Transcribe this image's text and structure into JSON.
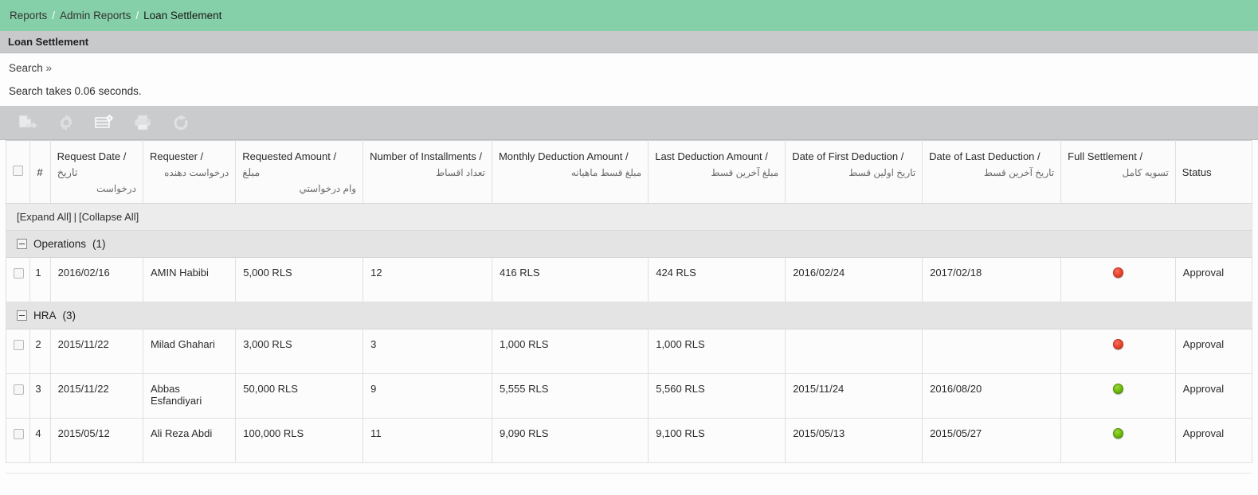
{
  "breadcrumb": {
    "items": [
      "Reports",
      "Admin Reports",
      "Loan Settlement"
    ],
    "separator": "/"
  },
  "page": {
    "title": "Loan Settlement"
  },
  "search": {
    "link_label": "Search",
    "chevron": "»",
    "timing_text": "Search takes 0.06 seconds."
  },
  "toolbar": {
    "buttons": [
      {
        "name": "export-document-icon",
        "title": "Export"
      },
      {
        "name": "settings-gear-icon",
        "title": "Settings"
      },
      {
        "name": "table-settings-icon",
        "title": "Column Settings"
      },
      {
        "name": "print-icon",
        "title": "Print"
      },
      {
        "name": "refresh-icon",
        "title": "Refresh"
      }
    ]
  },
  "grid": {
    "select_all_checkbox": false,
    "columns": [
      {
        "en": "#",
        "fa": ""
      },
      {
        "en": "Request Date /",
        "fa_inline": "تاریخ",
        "fa": "درخواست"
      },
      {
        "en": "Requester /",
        "fa_inline": "",
        "fa": "درخواست دهنده"
      },
      {
        "en": "Requested Amount /",
        "fa_inline": "مبلغ",
        "fa": "وام درخواستي"
      },
      {
        "en": "Number of Installments /",
        "fa_inline": "",
        "fa": "تعداد اقساط"
      },
      {
        "en": "Monthly Deduction Amount /",
        "fa_inline": "",
        "fa": "مبلغ قسط ماهیانه"
      },
      {
        "en": "Last Deduction Amount /",
        "fa_inline": "",
        "fa": "مبلغ آخرین قسط"
      },
      {
        "en": "Date of First Deduction /",
        "fa_inline": "",
        "fa": "تاریخ اولین قسط"
      },
      {
        "en": "Date of Last Deduction /",
        "fa_inline": "",
        "fa": "تاریخ آخرین قسط"
      },
      {
        "en": "Full Settlement /",
        "fa_inline": "",
        "fa": "تسویه کامل"
      },
      {
        "en": "Status",
        "fa_inline": "",
        "fa": ""
      }
    ],
    "expand_all_label": "[Expand All]",
    "collapse_all_label": "[Collapse All]",
    "separator": "|",
    "groups": [
      {
        "name": "Operations",
        "count": "(1)",
        "rows": [
          {
            "num": "1",
            "request_date": "2016/02/16",
            "requester": "AMIN Habibi",
            "requested_amount": "5,000 RLS",
            "installments": "12",
            "monthly_deduction": "416 RLS",
            "last_deduction": "424 RLS",
            "first_deduction_date": "2016/02/24",
            "last_deduction_date": "2017/02/18",
            "full_settlement": "red",
            "status": "Approval"
          }
        ]
      },
      {
        "name": "HRA",
        "count": "(3)",
        "rows": [
          {
            "num": "2",
            "request_date": "2015/11/22",
            "requester": "Milad Ghahari",
            "requested_amount": "3,000 RLS",
            "installments": "3",
            "monthly_deduction": "1,000 RLS",
            "last_deduction": "1,000 RLS",
            "first_deduction_date": "",
            "last_deduction_date": "",
            "full_settlement": "red",
            "status": "Approval"
          },
          {
            "num": "3",
            "request_date": "2015/11/22",
            "requester": "Abbas Esfandiyari",
            "requested_amount": "50,000 RLS",
            "installments": "9",
            "monthly_deduction": "5,555 RLS",
            "last_deduction": "5,560 RLS",
            "first_deduction_date": "2015/11/24",
            "last_deduction_date": "2016/08/20",
            "full_settlement": "green",
            "status": "Approval"
          },
          {
            "num": "4",
            "request_date": "2015/05/12",
            "requester": "Ali Reza Abdi",
            "requested_amount": "100,000 RLS",
            "installments": "11",
            "monthly_deduction": "9,090 RLS",
            "last_deduction": "9,100 RLS",
            "first_deduction_date": "2015/05/13",
            "last_deduction_date": "2015/05/27",
            "full_settlement": "green",
            "status": "Approval"
          }
        ]
      }
    ]
  },
  "colors": {
    "breadcrumb_bg": "#85d0a9",
    "pagehead_bg": "#c7c9cb",
    "toolbar_bg": "#c9cbcd",
    "group_bg": "#e4e4e4",
    "status_red": "#e8432a",
    "status_green": "#6eb90a"
  }
}
